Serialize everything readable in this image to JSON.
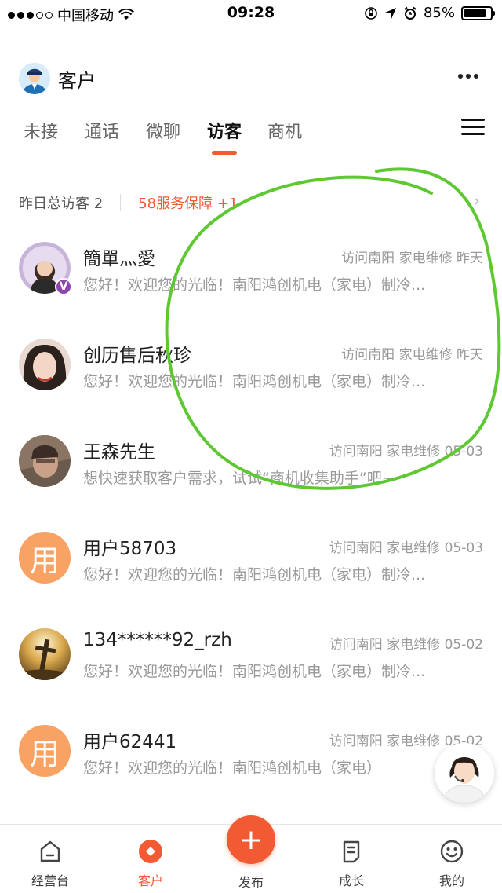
{
  "status_bar": {
    "carrier": "中国移动",
    "time": "09:28",
    "battery": "85%",
    "battery_level": 0.85
  },
  "header": {
    "title": "客户"
  },
  "tabs": [
    {
      "label": "未接"
    },
    {
      "label": "通话"
    },
    {
      "label": "微聊"
    },
    {
      "label": "访客"
    },
    {
      "label": "商机"
    }
  ],
  "summary": {
    "left": "昨日总访客 2",
    "right": "58服务保障 +1"
  },
  "rows": [
    {
      "name": "簡單灬愛",
      "meta": "访问南阳 家电维修 昨天",
      "msg": "您好！欢迎您的光临！南阳鸿创机电（家电）制冷...",
      "avatar_text": "",
      "avatar_badge": "V"
    },
    {
      "name": "创历售后秋珍",
      "meta": "访问南阳 家电维修 昨天",
      "msg": "您好！欢迎您的光临！南阳鸿创机电（家电）制冷...",
      "avatar_text": ""
    },
    {
      "name": "王森先生",
      "meta": "访问南阳 家电维修 05-03",
      "msg": "想快速获取客户需求，试试“商机收集助手”吧~",
      "avatar_text": ""
    },
    {
      "name": "用户58703",
      "meta": "访问南阳 家电维修 05-03",
      "msg": "您好！欢迎您的光临！南阳鸿创机电（家电）制冷...",
      "avatar_text": "用"
    },
    {
      "name": "134******92_rzh",
      "meta": "访问南阳 家电维修 05-02",
      "msg": "您好！欢迎您的光临！南阳鸿创机电（家电）制冷...",
      "avatar_text": ""
    },
    {
      "name": "用户62441",
      "meta": "访问南阳 家电维修 05-02",
      "msg": "您好！欢迎您的光临！南阳鸿创机电（家电）",
      "avatar_text": "用"
    }
  ],
  "bottom_nav": [
    {
      "label": "经营台"
    },
    {
      "label": "客户"
    },
    {
      "label": "发布",
      "icon": "+"
    },
    {
      "label": "成长"
    },
    {
      "label": "我的"
    }
  ],
  "colors": {
    "accent": "#f15a33",
    "avatar_orange": "#f8a264",
    "annotation_green": "#5ec832"
  }
}
